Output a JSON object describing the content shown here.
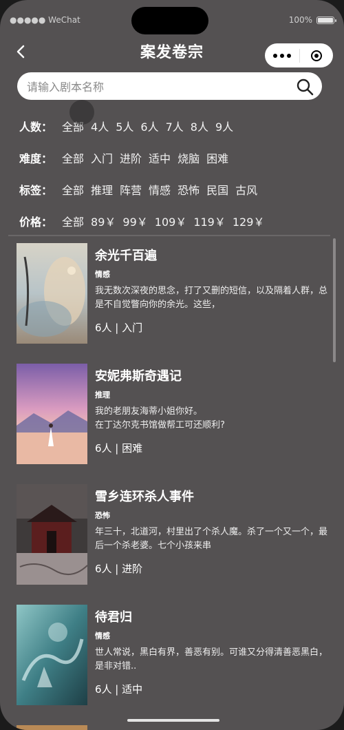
{
  "status_bar": {
    "carrier": "●●●●● WeChat",
    "battery": "100%"
  },
  "nav": {
    "title": "案发卷宗"
  },
  "search": {
    "placeholder": "请输入剧本名称"
  },
  "filters": [
    {
      "label": "人数：",
      "options": [
        "全部",
        "4人",
        "5人",
        "6人",
        "7人",
        "8人",
        "9人"
      ]
    },
    {
      "label": "难度：",
      "options": [
        "全部",
        "入门",
        "进阶",
        "适中",
        "烧脑",
        "困难"
      ]
    },
    {
      "label": "标签：",
      "options": [
        "全部",
        "推理",
        "阵营",
        "情感",
        "恐怖",
        "民国",
        "古风"
      ]
    },
    {
      "label": "价格：",
      "options": [
        "全部",
        "89￥",
        "99￥",
        "109￥",
        "119￥",
        "129￥"
      ]
    }
  ],
  "scripts": [
    {
      "name": "余光千百遍",
      "tag": "情感",
      "desc": "我无数次深夜的思念，打了又删的短信，以及隔着人群，总是不自觉瞥向你的余光。这些，",
      "meta": "6人 | 入门"
    },
    {
      "name": "安妮弗斯奇遇记",
      "tag": "推理",
      "desc": "我的老朋友海蒂小姐你好。\n在丁达尔克书馆做帮工可还顺利?",
      "meta": "6人 | 困难"
    },
    {
      "name": "雪乡连环杀人事件",
      "tag": "恐怖",
      "desc": "年三十，北道河，村里出了个杀人魔。杀了一个又一个，最后一个杀老婆。七个小孩来串",
      "meta": "6人 | 进阶"
    },
    {
      "name": "待君归",
      "tag": "情感",
      "desc": "世人常说，黑白有界，善恶有别。可谁又分得清善恶黑白，是非对错..",
      "meta": "6人 | 适中"
    }
  ],
  "colors": {
    "background": "#545152",
    "accent": "#ffffff"
  }
}
